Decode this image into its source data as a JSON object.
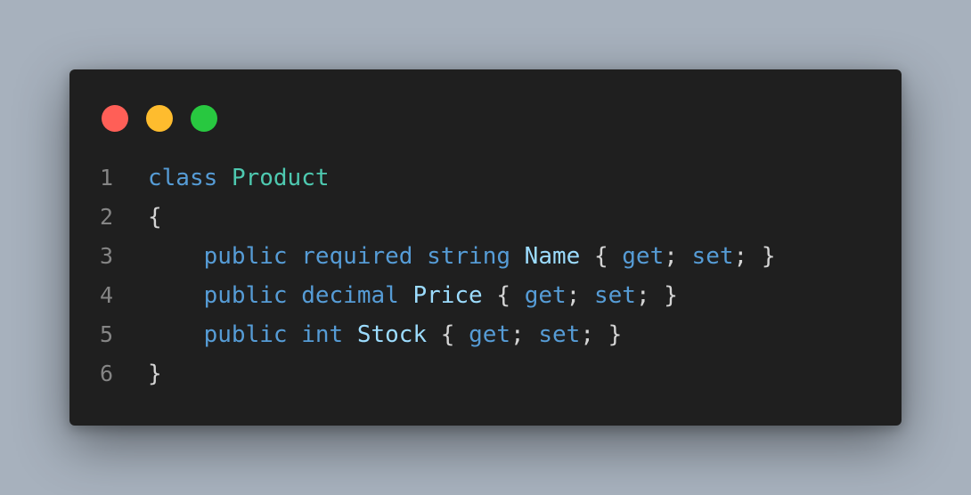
{
  "colors": {
    "background": "#a7b1bd",
    "window": "#1f1f1f",
    "close_dot": "#ff5f57",
    "minimize_dot": "#febc2e",
    "maximize_dot": "#28c840",
    "keyword": "#569cd6",
    "type": "#4ec9b0",
    "identifier": "#9cdcfe",
    "punctuation": "#d4d4d4",
    "line_number": "#858585"
  },
  "window_controls": [
    {
      "name": "close-dot",
      "color": "#ff5f57"
    },
    {
      "name": "minimize-dot",
      "color": "#febc2e"
    },
    {
      "name": "maximize-dot",
      "color": "#28c840"
    }
  ],
  "code": {
    "lines": [
      {
        "number": "1",
        "tokens": [
          {
            "text": "class",
            "kind": "kw"
          },
          {
            "text": " ",
            "kind": "pn"
          },
          {
            "text": "Product",
            "kind": "ty"
          }
        ]
      },
      {
        "number": "2",
        "tokens": [
          {
            "text": "{",
            "kind": "pn"
          }
        ]
      },
      {
        "number": "3",
        "tokens": [
          {
            "text": "    ",
            "kind": "pn"
          },
          {
            "text": "public",
            "kind": "kw"
          },
          {
            "text": " ",
            "kind": "pn"
          },
          {
            "text": "required",
            "kind": "kw"
          },
          {
            "text": " ",
            "kind": "pn"
          },
          {
            "text": "string",
            "kind": "kw"
          },
          {
            "text": " ",
            "kind": "pn"
          },
          {
            "text": "Name",
            "kind": "id"
          },
          {
            "text": " { ",
            "kind": "pn"
          },
          {
            "text": "get",
            "kind": "kw"
          },
          {
            "text": "; ",
            "kind": "pn"
          },
          {
            "text": "set",
            "kind": "kw"
          },
          {
            "text": "; }",
            "kind": "pn"
          }
        ]
      },
      {
        "number": "4",
        "tokens": [
          {
            "text": "    ",
            "kind": "pn"
          },
          {
            "text": "public",
            "kind": "kw"
          },
          {
            "text": " ",
            "kind": "pn"
          },
          {
            "text": "decimal",
            "kind": "kw"
          },
          {
            "text": " ",
            "kind": "pn"
          },
          {
            "text": "Price",
            "kind": "id"
          },
          {
            "text": " { ",
            "kind": "pn"
          },
          {
            "text": "get",
            "kind": "kw"
          },
          {
            "text": "; ",
            "kind": "pn"
          },
          {
            "text": "set",
            "kind": "kw"
          },
          {
            "text": "; }",
            "kind": "pn"
          }
        ]
      },
      {
        "number": "5",
        "tokens": [
          {
            "text": "    ",
            "kind": "pn"
          },
          {
            "text": "public",
            "kind": "kw"
          },
          {
            "text": " ",
            "kind": "pn"
          },
          {
            "text": "int",
            "kind": "kw"
          },
          {
            "text": " ",
            "kind": "pn"
          },
          {
            "text": "Stock",
            "kind": "id"
          },
          {
            "text": " { ",
            "kind": "pn"
          },
          {
            "text": "get",
            "kind": "kw"
          },
          {
            "text": "; ",
            "kind": "pn"
          },
          {
            "text": "set",
            "kind": "kw"
          },
          {
            "text": "; }",
            "kind": "pn"
          }
        ]
      },
      {
        "number": "6",
        "tokens": [
          {
            "text": "}",
            "kind": "pn"
          }
        ]
      }
    ]
  }
}
